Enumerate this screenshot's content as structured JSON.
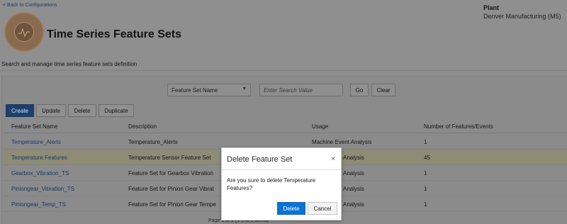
{
  "header": {
    "back_link": "< Back to Configurations",
    "plant_label": "Plant",
    "plant_value": "Denver Manufacturing (M5)",
    "title": "Time Series Feature Sets",
    "subtitle": "Search and manage time series feature sets definition"
  },
  "search": {
    "field_selected": "Feature Set Name",
    "placeholder": "Enter Search Value",
    "go_label": "Go",
    "clear_label": "Clear"
  },
  "toolbar": {
    "create": "Create",
    "update": "Update",
    "delete": "Delete",
    "duplicate": "Duplicate"
  },
  "table": {
    "columns": [
      "Feature Set Name",
      "Description",
      "Usage",
      "Number of Features/Events"
    ],
    "rows": [
      {
        "name": "Temperature_Alerts",
        "description": "Temperature_Alerts",
        "usage": "Machine Event Analysis",
        "count": "1"
      },
      {
        "name": "Temperature Features",
        "description": "Temperature Sensor Feature Set",
        "usage": "Analysis",
        "count": "45"
      },
      {
        "name": "Gearbox_Vibration_TS",
        "description": "Feature Set for Gearbox Vibration",
        "usage": "Analysis",
        "count": "1"
      },
      {
        "name": "Piniongear_Vibration_TS",
        "description": "Feature Set for Pinion Gear Vibrat",
        "usage": "Analysis",
        "count": "1"
      },
      {
        "name": "Piniongear_Temp_TS",
        "description": "Feature Set for Pinion Gear Tempe",
        "usage": "Analysis",
        "count": "1"
      }
    ]
  },
  "pager": "Page  1  of 1  (1-5 of 5 items)",
  "dialog": {
    "title": "Delete Feature Set",
    "close": "×",
    "message": "Are you sure to delete Temperature Features?",
    "delete_label": "Delete",
    "cancel_label": "Cancel"
  }
}
